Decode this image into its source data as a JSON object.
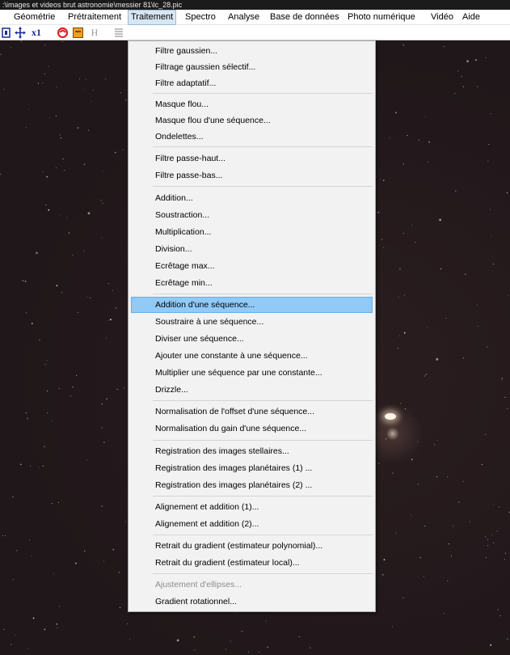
{
  "window": {
    "title": ":\\images et videos brut astronomie\\messier 81\\lc_28.pic"
  },
  "menubar": {
    "items": [
      {
        "label": "Géométrie"
      },
      {
        "label": "Prétraitement"
      },
      {
        "label": "Traitement"
      },
      {
        "label": "Spectro"
      },
      {
        "label": "Analyse"
      },
      {
        "label": "Base de données"
      },
      {
        "label": "Photo numérique"
      },
      {
        "label": "Vidéo"
      },
      {
        "label": "Aide"
      }
    ],
    "active": "Traitement"
  },
  "toolbar": {
    "buttons": [
      {
        "icon": "frame-icon"
      },
      {
        "icon": "move-icon"
      },
      {
        "label": "x1"
      },
      {
        "icon": "red-swirl-icon"
      },
      {
        "icon": "orange-square-icon"
      },
      {
        "label": "H"
      },
      {
        "icon": "list-icon"
      }
    ]
  },
  "menu": {
    "items": [
      {
        "label": "Filtre gaussien..."
      },
      {
        "label": "Filtrage gaussien sélectif..."
      },
      {
        "label": "Filtre adaptatif..."
      },
      {
        "label": "Masque flou..."
      },
      {
        "label": "Masque flou d'une séquence..."
      },
      {
        "label": "Ondelettes..."
      },
      {
        "label": "Filtre passe-haut..."
      },
      {
        "label": "Filtre passe-bas..."
      },
      {
        "label": "Addition..."
      },
      {
        "label": "Soustraction..."
      },
      {
        "label": "Multiplication..."
      },
      {
        "label": "Division..."
      },
      {
        "label": "Ecrêtage max..."
      },
      {
        "label": "Ecrêtage min..."
      },
      {
        "label": "Addition d'une séquence...",
        "highlighted": true
      },
      {
        "label": "Soustraire à une séquence..."
      },
      {
        "label": "Diviser une séquence..."
      },
      {
        "label": "Ajouter une constante à une séquence..."
      },
      {
        "label": "Multiplier une séquence par une constante..."
      },
      {
        "label": "Drizzle..."
      },
      {
        "label": "Normalisation de l'offset d'une séquence..."
      },
      {
        "label": "Normalisation du gain d'une séquence..."
      },
      {
        "label": "Registration des images stellaires..."
      },
      {
        "label": "Registration des images planétaires (1) ..."
      },
      {
        "label": "Registration des images planétaires (2) ..."
      },
      {
        "label": "Alignement et addition (1)..."
      },
      {
        "label": "Alignement et addition (2)..."
      },
      {
        "label": "Retrait du gradient (estimateur polynomial)..."
      },
      {
        "label": "Retrait du gradient (estimateur local)..."
      },
      {
        "label": "Ajustement d'ellipses...",
        "disabled": true
      },
      {
        "label": "Gradient rotationnel..."
      }
    ]
  },
  "colors": {
    "sky": "#22181b",
    "menu_bg": "#f2f2f2",
    "highlight": "#91c9f7",
    "active_menu": "#d8e6f2"
  }
}
